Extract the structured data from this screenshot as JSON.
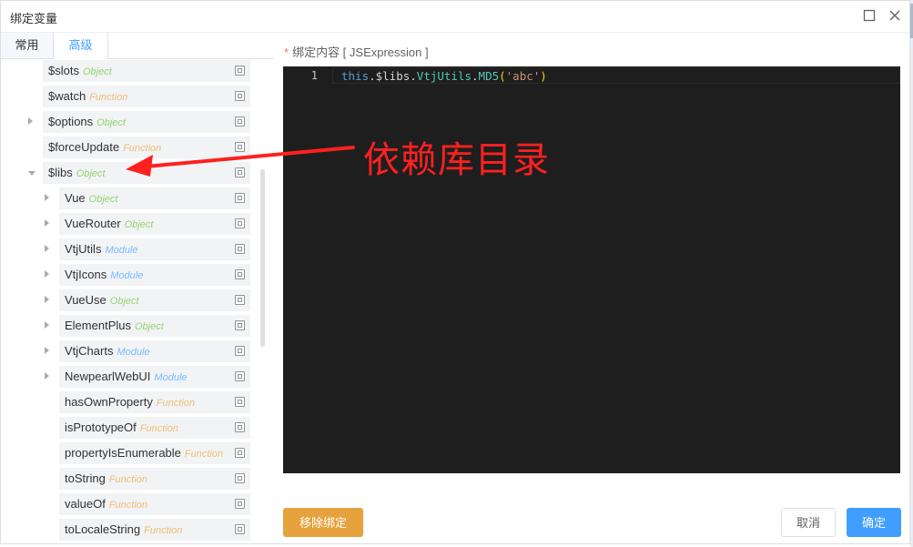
{
  "dialog": {
    "title": "绑定变量",
    "maximize_icon": "square-icon",
    "close_icon": "close-icon"
  },
  "tabs": [
    {
      "label": "常用",
      "active": false
    },
    {
      "label": "高级",
      "active": true
    }
  ],
  "tree": [
    {
      "name": "$slots",
      "type": "Object",
      "kind": "object",
      "indent": 1,
      "caret": "none"
    },
    {
      "name": "$watch",
      "type": "Function",
      "kind": "function",
      "indent": 1,
      "caret": "none"
    },
    {
      "name": "$options",
      "type": "Object",
      "kind": "object",
      "indent": 1,
      "caret": "right"
    },
    {
      "name": "$forceUpdate",
      "type": "Function",
      "kind": "function",
      "indent": 1,
      "caret": "none"
    },
    {
      "name": "$libs",
      "type": "Object",
      "kind": "object",
      "indent": 1,
      "caret": "down"
    },
    {
      "name": "Vue",
      "type": "Object",
      "kind": "object",
      "indent": 2,
      "caret": "right"
    },
    {
      "name": "VueRouter",
      "type": "Object",
      "kind": "object",
      "indent": 2,
      "caret": "right"
    },
    {
      "name": "VtjUtils",
      "type": "Module",
      "kind": "module",
      "indent": 2,
      "caret": "right"
    },
    {
      "name": "VtjIcons",
      "type": "Module",
      "kind": "module",
      "indent": 2,
      "caret": "right"
    },
    {
      "name": "VueUse",
      "type": "Object",
      "kind": "object",
      "indent": 2,
      "caret": "right"
    },
    {
      "name": "ElementPlus",
      "type": "Object",
      "kind": "object",
      "indent": 2,
      "caret": "right"
    },
    {
      "name": "VtjCharts",
      "type": "Module",
      "kind": "module",
      "indent": 2,
      "caret": "right"
    },
    {
      "name": "NewpearlWebUI",
      "type": "Module",
      "kind": "module",
      "indent": 2,
      "caret": "right"
    },
    {
      "name": "hasOwnProperty",
      "type": "Function",
      "kind": "function",
      "indent": 2,
      "caret": "none"
    },
    {
      "name": "isPrototypeOf",
      "type": "Function",
      "kind": "function",
      "indent": 2,
      "caret": "none"
    },
    {
      "name": "propertyIsEnumerable",
      "type": "Function",
      "kind": "function",
      "indent": 2,
      "caret": "none"
    },
    {
      "name": "toString",
      "type": "Function",
      "kind": "function",
      "indent": 2,
      "caret": "none"
    },
    {
      "name": "valueOf",
      "type": "Function",
      "kind": "function",
      "indent": 2,
      "caret": "none"
    },
    {
      "name": "toLocaleString",
      "type": "Function",
      "kind": "function",
      "indent": 2,
      "caret": "none"
    }
  ],
  "editor": {
    "label": "绑定内容 [ JSExpression ]",
    "required_mark": "*",
    "line_number": "1",
    "code_tokens": [
      {
        "text": "this",
        "cls": "tk-kw"
      },
      {
        "text": ".$libs.",
        "cls": "tk-var"
      },
      {
        "text": "VtjUtils",
        "cls": "tk-cls"
      },
      {
        "text": ".",
        "cls": "tk-var"
      },
      {
        "text": "MD5",
        "cls": "tk-fn"
      },
      {
        "text": "(",
        "cls": "tk-paren"
      },
      {
        "text": "'abc'",
        "cls": "tk-str"
      },
      {
        "text": ")",
        "cls": "tk-paren"
      }
    ]
  },
  "annotation": {
    "text": "依赖库目录",
    "color": "#ff2020"
  },
  "footer": {
    "unbind_label": "移除绑定",
    "cancel_label": "取消",
    "ok_label": "确定"
  },
  "colors": {
    "primary": "#409eff",
    "warning": "#e6a23c",
    "object_type": "#95d475",
    "function_type": "#eebe77",
    "module_type": "#79bbff"
  }
}
